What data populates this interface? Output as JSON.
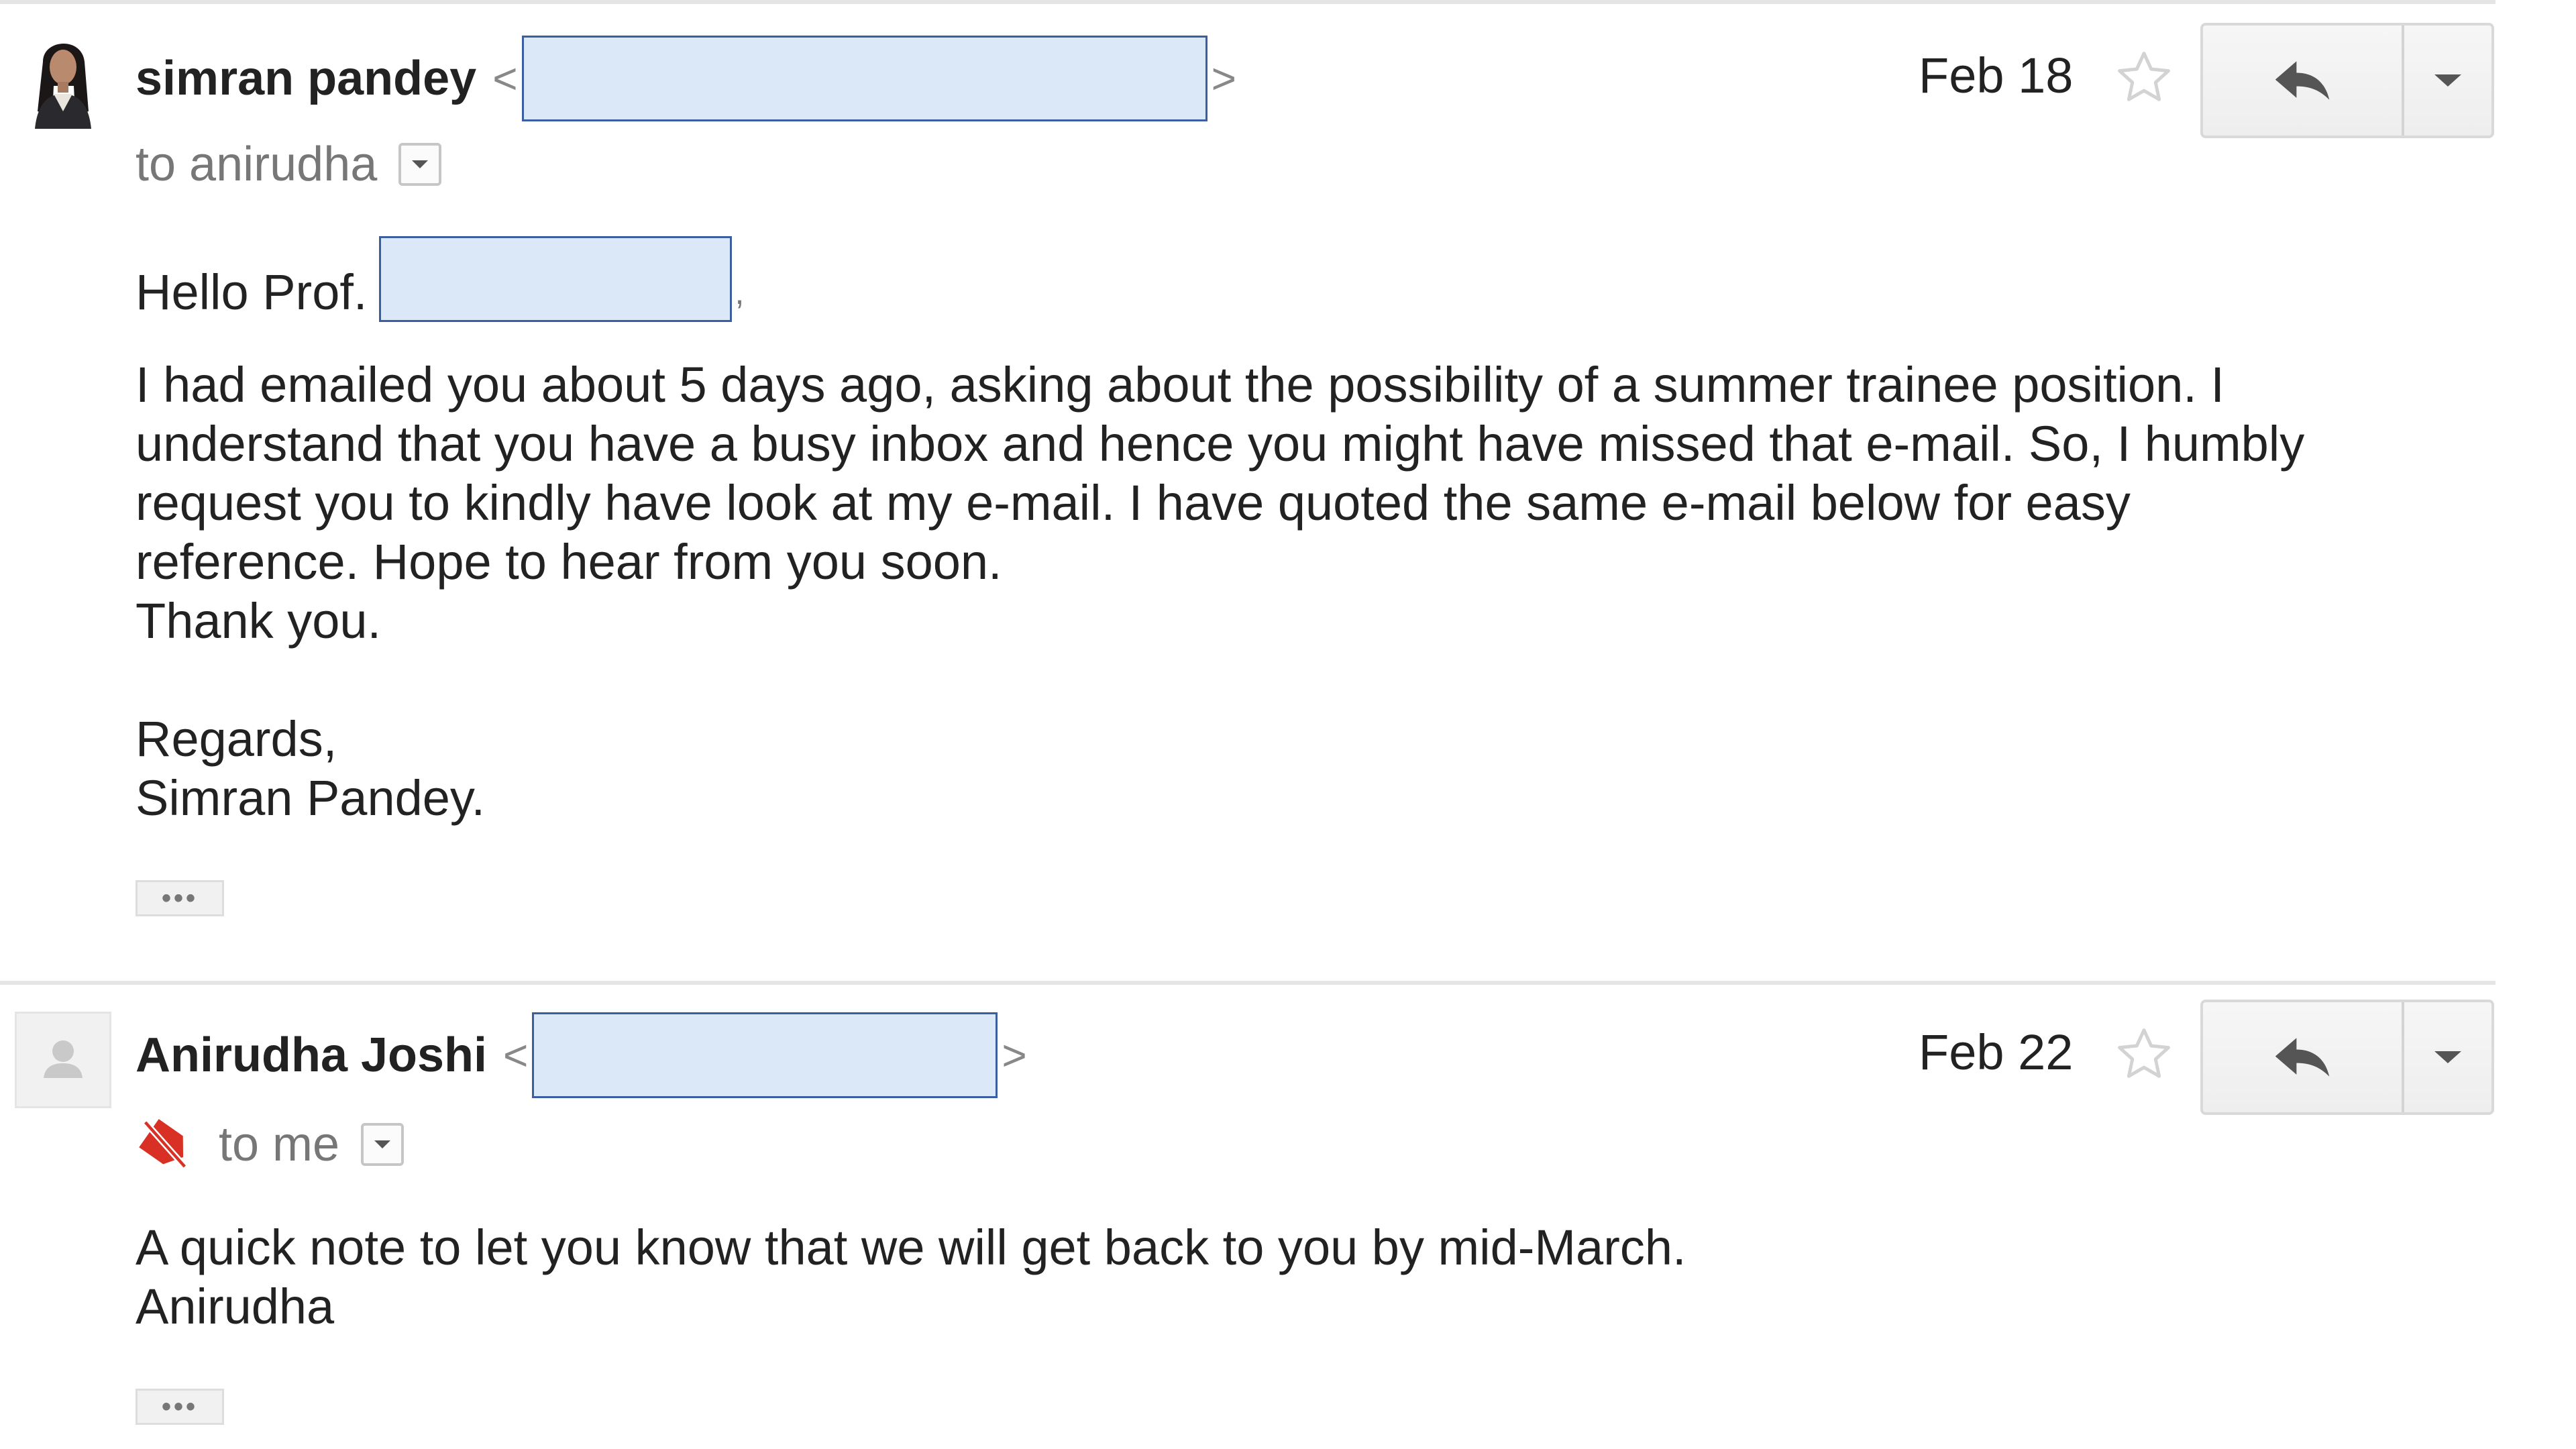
{
  "messages": [
    {
      "sender_name": "simran pandey",
      "email_open": "<",
      "email_close": ">",
      "recipient": "to anirudha",
      "date": "Feb 18",
      "greeting": "Hello Prof.",
      "greeting_comma": ",",
      "body_lines": [
        "I had emailed you about 5 days ago, asking about the possibility of a summer trainee position. I",
        "understand that you have a busy inbox and hence you might have missed that e-mail. So, I humbly",
        "request you to kindly have look at my e-mail. I have quoted the same e-mail below for easy",
        "reference. Hope to hear from you soon.",
        "Thank you."
      ],
      "signoff": "Regards,",
      "signature": "Simran Pandey.",
      "trimmed_label": "•••",
      "avatar": "person-photo-icon"
    },
    {
      "sender_name": "Anirudha Joshi",
      "email_open": "<",
      "email_close": ">",
      "recipient": "to me",
      "date": "Feb 22",
      "body_lines": [
        "A quick note to let you know that we will get back to you by mid-March.",
        "Anirudha"
      ],
      "trimmed_label": "•••",
      "avatar": "default-person-icon",
      "importance_icon": "not-important-icon"
    }
  ],
  "colors": {
    "redaction_fill": "#dbe8f7",
    "redaction_border": "#3a5ea0",
    "importance_red": "#d93025"
  }
}
